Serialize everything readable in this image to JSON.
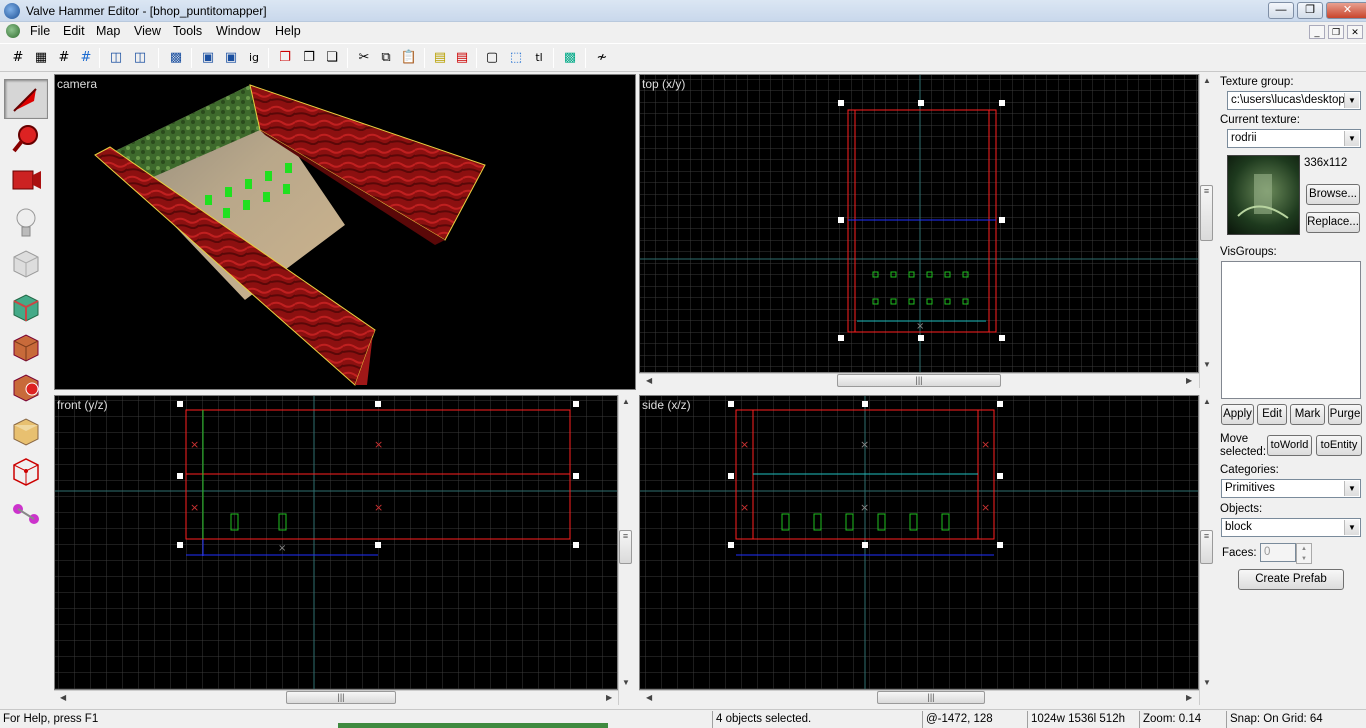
{
  "window": {
    "title": "Valve Hammer Editor - [bhop_puntitomapper]"
  },
  "menu": [
    "File",
    "Edit",
    "Map",
    "View",
    "Tools",
    "Window",
    "Help"
  ],
  "toolbar": {
    "text_tool": "tl"
  },
  "viewports": {
    "camera": {
      "label": "camera"
    },
    "top": {
      "label": "top (x/y)"
    },
    "front": {
      "label": "front (y/z)"
    },
    "side": {
      "label": "side (x/z)"
    }
  },
  "texture": {
    "group_label": "Texture group:",
    "group_value": "c:\\users\\lucas\\desktop\\",
    "current_label": "Current texture:",
    "current_value": "rodrii",
    "size": "336x112",
    "browse": "Browse...",
    "replace": "Replace..."
  },
  "visgroups": {
    "label": "VisGroups:",
    "apply": "Apply",
    "edit": "Edit",
    "mark": "Mark",
    "purge": "Purge"
  },
  "move": {
    "label": "Move selected:",
    "to_world": "toWorld",
    "to_entity": "toEntity"
  },
  "categories": {
    "label": "Categories:",
    "value": "Primitives"
  },
  "objects": {
    "label": "Objects:",
    "value": "block"
  },
  "faces": {
    "label": "Faces:",
    "value": "0"
  },
  "create_prefab": "Create Prefab",
  "status": {
    "help": "For Help, press F1",
    "selection": "4 objects selected.",
    "coords": "@-1472, 128",
    "dims": "1024w 1536l 512h",
    "zoom": "Zoom: 0.14",
    "snap": "Snap: On Grid: 64"
  },
  "colors": {
    "selection": "#ff2020",
    "grid": "#3a3a3a",
    "axis": "#2f6f6f",
    "prefab": "#20c020"
  }
}
